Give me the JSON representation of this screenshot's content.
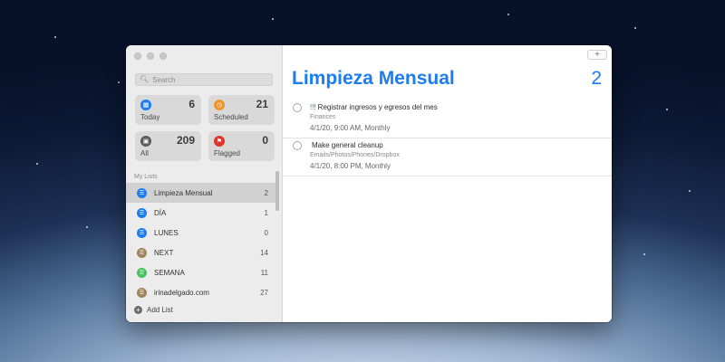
{
  "colors": {
    "accent": "#1b7df2",
    "blue": "#1b7df2",
    "orange": "#f0932b",
    "dark": "#5a5a5a",
    "red": "#e0352c",
    "brown": "#a0845c",
    "green": "#44c45a"
  },
  "sidebar": {
    "search_placeholder": "Search",
    "tiles": [
      {
        "label": "Today",
        "count": "6",
        "icon": "calendar-icon"
      },
      {
        "label": "Scheduled",
        "count": "21",
        "icon": "clock-icon"
      },
      {
        "label": "All",
        "count": "209",
        "icon": "tray-icon"
      },
      {
        "label": "Flagged",
        "count": "0",
        "icon": "flag-icon"
      }
    ],
    "my_lists_header": "My Lists",
    "lists": [
      {
        "name": "Limpieza Mensual",
        "count": "2",
        "icon": "list-icon"
      },
      {
        "name": "DÍA",
        "count": "1",
        "icon": "list-icon"
      },
      {
        "name": "LUNES",
        "count": "0",
        "icon": "list-icon"
      },
      {
        "name": "NEXT",
        "count": "14",
        "icon": "list-icon"
      },
      {
        "name": "SEMANA",
        "count": "11",
        "icon": "list-icon"
      },
      {
        "name": "irinadelgado.com",
        "count": "27",
        "icon": "list-icon"
      }
    ],
    "add_list_label": "Add List"
  },
  "main": {
    "add_button": "+",
    "title": "Limpieza Mensual",
    "count": "2",
    "tasks": [
      {
        "priority": "!!!",
        "title": "Registrar ingresos y egresos del mes",
        "tag": "Finances",
        "due": "4/1/20, 9:00 AM, Monthly"
      },
      {
        "priority": "",
        "title": "Make general cleanup",
        "tag": "Emails/Photos/Phones/Dropbox",
        "due": "4/1/20, 8:00 PM, Monthly"
      }
    ]
  }
}
